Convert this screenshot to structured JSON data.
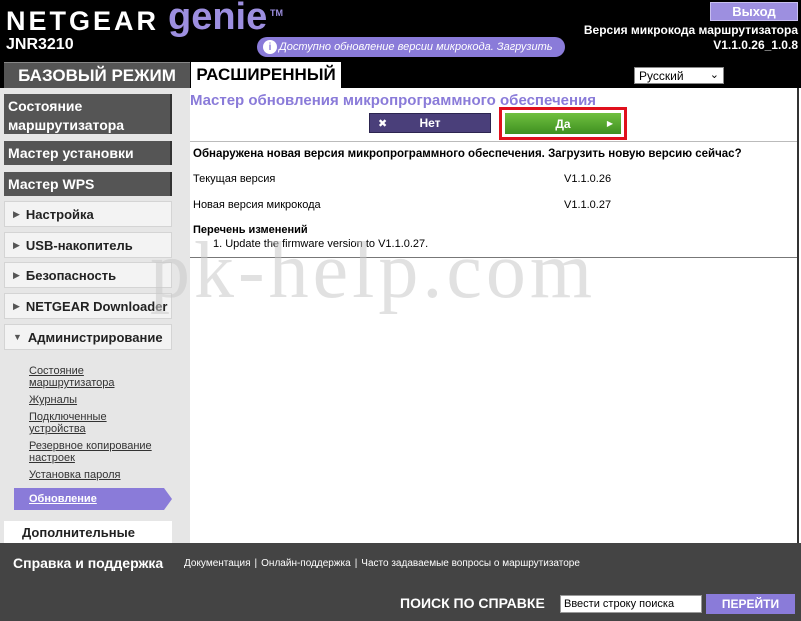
{
  "header": {
    "brand": "NETGEAR",
    "brand_genie": "genie",
    "tm": "TM",
    "model": "JNR3210",
    "update_notice": "Доступно обновление версии микрокода. Загрузить",
    "logout_label": "Выход",
    "firmware_label": "Версия микрокода маршрутизатора",
    "firmware_version": "V1.1.0.26_1.0.8",
    "tab_basic": "БАЗОВЫЙ РЕЖИМ",
    "tab_advanced": "РАСШИРЕННЫЙ",
    "language_selected": "Русский"
  },
  "sidebar": {
    "router_status": "Состояние маршрутизатора",
    "setup_wizard": "Мастер установки",
    "wps_wizard": "Мастер WPS",
    "menu": [
      {
        "label": "Настройка",
        "expanded": false
      },
      {
        "label": "USB-накопитель",
        "expanded": false
      },
      {
        "label": "Безопасность",
        "expanded": false
      },
      {
        "label": "NETGEAR Downloader",
        "expanded": false
      },
      {
        "label": "Администрирование",
        "expanded": true
      }
    ],
    "admin_items": [
      "Состояние маршрутизатора",
      "Журналы",
      "Подключенные устройства",
      "Резервное копирование настроек",
      "Установка пароля"
    ],
    "active_item": "Обновление",
    "extra": "Дополнительные"
  },
  "main": {
    "title": "Мастер обновления микропрограммного обеспечения",
    "no_label": "Нет",
    "yes_label": "Да",
    "question": "Обнаружена новая версия микропрограммного обеспечения. Загрузить новую версию сейчас?",
    "current_label": "Текущая версия",
    "current_value": "V1.1.0.26",
    "new_label": "Новая версия микрокода",
    "new_value": "V1.1.0.27",
    "changes_title": "Перечень изменений",
    "changes_item": "1.   Update the firmware version to V1.1.0.27.",
    "watermark": "pk-help.com"
  },
  "footer": {
    "title": "Справка и поддержка",
    "links": [
      "Документация",
      "Онлайн-поддержка",
      "Часто задаваемые вопросы о маршрутизаторе"
    ],
    "search_label": "ПОИСК ПО СПРАВКЕ",
    "search_placeholder": "Ввести строку поиска",
    "search_button": "ПЕРЕЙТИ"
  },
  "colors": {
    "accent": "#8a7bd9",
    "yes_green": "#4fa82a",
    "highlight_red": "#e0101c",
    "dark": "#555555"
  }
}
